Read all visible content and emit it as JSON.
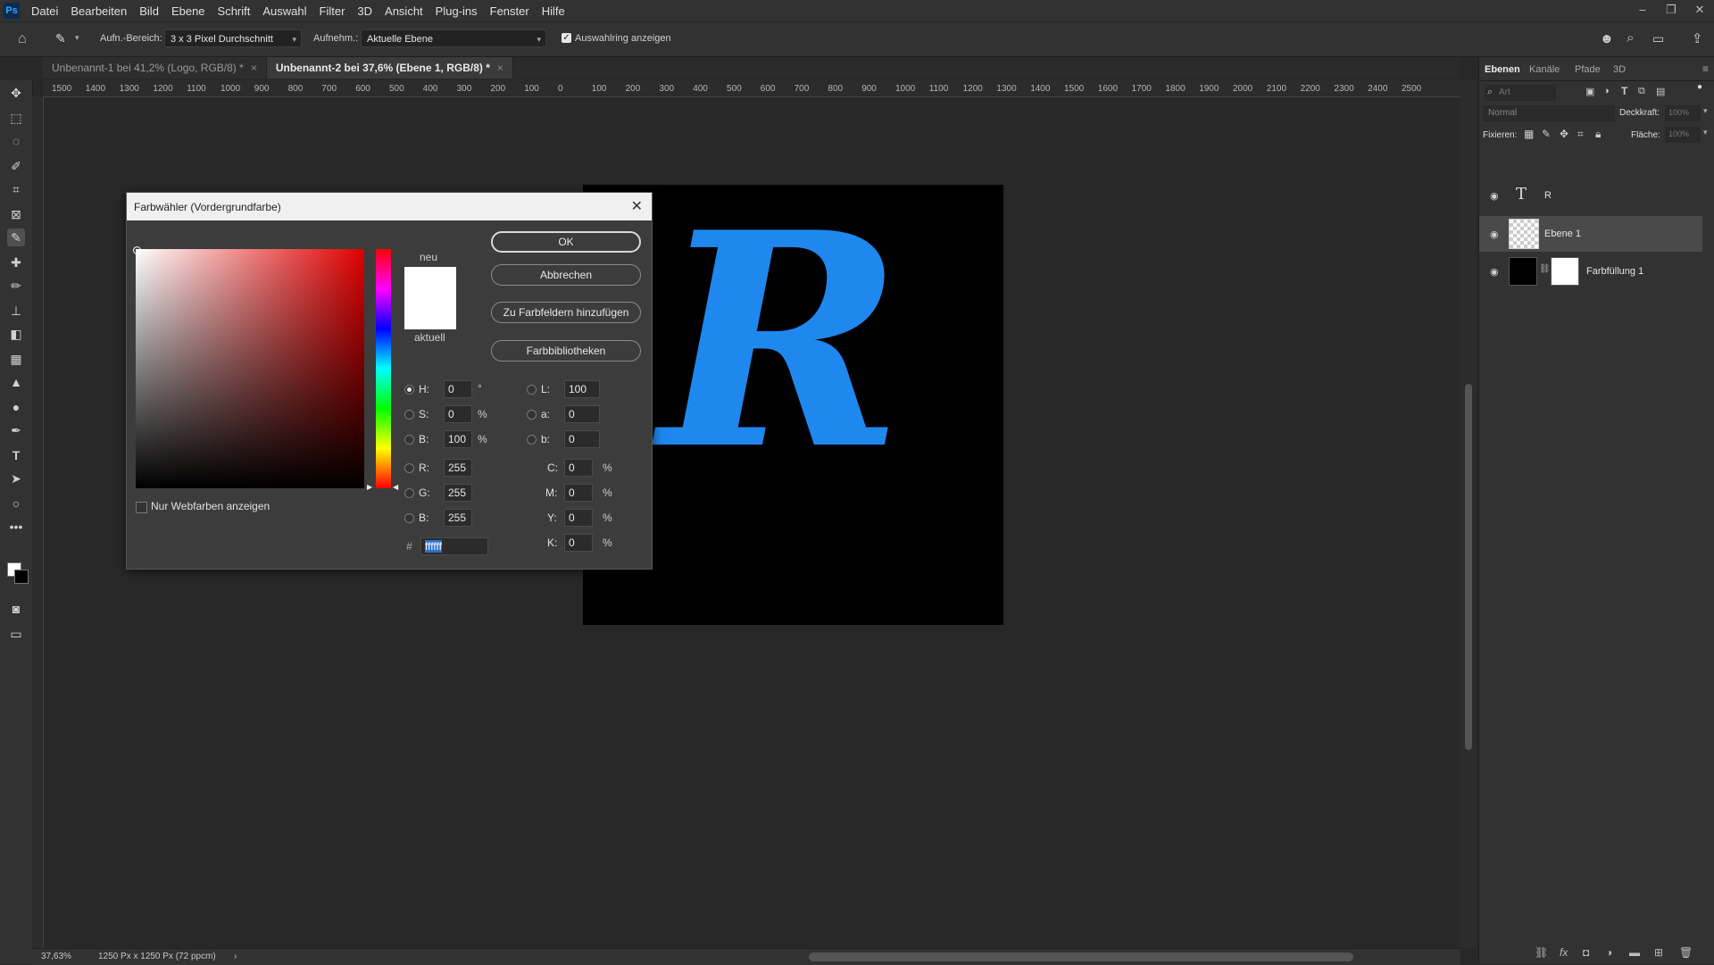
{
  "menubar": {
    "items": [
      "Datei",
      "Bearbeiten",
      "Bild",
      "Ebene",
      "Schrift",
      "Auswahl",
      "Filter",
      "3D",
      "Ansicht",
      "Plug-ins",
      "Fenster",
      "Hilfe"
    ]
  },
  "options": {
    "sample_size_label": "Aufn.-Bereich:",
    "sample_size_value": "3 x 3 Pixel Durchschnitt",
    "sample_label": "Aufnehm.:",
    "sample_value": "Aktuelle Ebene",
    "show_ring_label": "Auswahlring anzeigen"
  },
  "tabs": [
    {
      "label": "Unbenannt-1 bei 41,2% (Logo, RGB/8) *"
    },
    {
      "label": "Unbenannt-2 bei 37,6% (Ebene 1, RGB/8) *"
    }
  ],
  "ruler": {
    "ticks": [
      "1500",
      "1400",
      "1300",
      "1200",
      "1100",
      "1000",
      "900",
      "800",
      "700",
      "600",
      "500",
      "400",
      "300",
      "200",
      "100",
      "0",
      "100",
      "200",
      "300",
      "400",
      "500",
      "600",
      "700",
      "800",
      "900",
      "1000",
      "1100",
      "1200",
      "1300",
      "1400",
      "1500",
      "1600",
      "1700",
      "1800",
      "1900",
      "2000",
      "2100",
      "2200",
      "2300",
      "2400",
      "2500"
    ]
  },
  "canvas": {
    "letter": "R",
    "letter_color": "#1e88ef"
  },
  "dialog": {
    "title": "Farbwähler (Vordergrundfarbe)",
    "new_label": "neu",
    "current_label": "aktuell",
    "buttons": {
      "ok": "OK",
      "cancel": "Abbrechen",
      "add_swatch": "Zu Farbfeldern hinzufügen",
      "libraries": "Farbbibliotheken"
    },
    "web_only_label": "Nur Webfarben anzeigen",
    "fields": {
      "H": {
        "label": "H:",
        "value": "0",
        "unit": "°"
      },
      "S": {
        "label": "S:",
        "value": "0",
        "unit": "%"
      },
      "Bv": {
        "label": "B:",
        "value": "100",
        "unit": "%"
      },
      "R": {
        "label": "R:",
        "value": "255"
      },
      "G": {
        "label": "G:",
        "value": "255"
      },
      "Bl": {
        "label": "B:",
        "value": "255"
      },
      "L": {
        "label": "L:",
        "value": "100"
      },
      "a": {
        "label": "a:",
        "value": "0"
      },
      "b": {
        "label": "b:",
        "value": "0"
      },
      "C": {
        "label": "C:",
        "value": "0",
        "unit": "%"
      },
      "M": {
        "label": "M:",
        "value": "0",
        "unit": "%"
      },
      "Y": {
        "label": "Y:",
        "value": "0",
        "unit": "%"
      },
      "K": {
        "label": "K:",
        "value": "0",
        "unit": "%"
      }
    },
    "hex_label": "#",
    "hex_value": "ffffff"
  },
  "layers_panel": {
    "tabs": [
      "Ebenen",
      "Kanäle",
      "Pfade",
      "3D"
    ],
    "search_placeholder": "Art",
    "blend_mode": "Normal",
    "opacity_label": "Deckkraft:",
    "opacity_value": "100%",
    "lock_label": "Fixieren:",
    "fill_label": "Fläche:",
    "fill_value": "100%",
    "layers": [
      {
        "name": "R"
      },
      {
        "name": "Ebene 1"
      },
      {
        "name": "Farbfüllung 1"
      }
    ]
  },
  "status": {
    "zoom": "37,63%",
    "doc_size": "1250 Px x 1250 Px (72 ppcm)"
  }
}
